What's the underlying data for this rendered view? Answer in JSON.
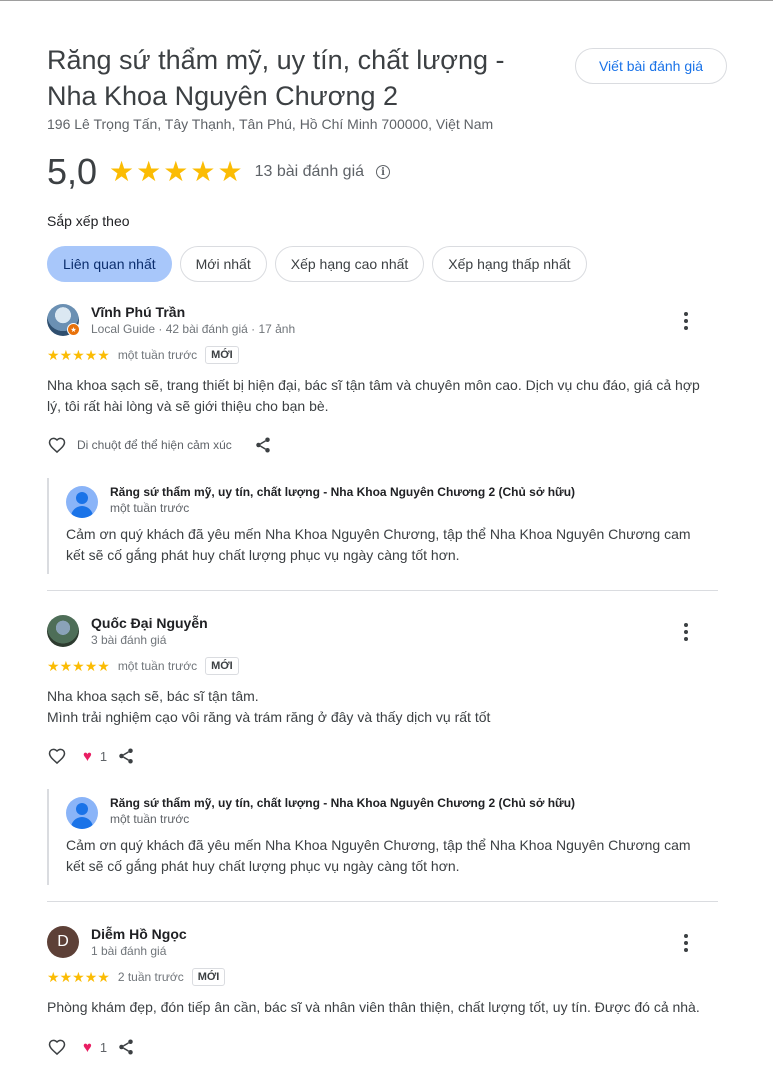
{
  "place": {
    "title": "Răng sứ thẩm mỹ, uy tín, chất lượng - Nha Khoa Nguyên Chương 2",
    "address": "196 Lê Trọng Tấn, Tây Thạnh, Tân Phú, Hồ Chí Minh 700000, Việt Nam",
    "write_review_label": "Viết bài đánh giá",
    "rating_value": "5,0",
    "rating_stars": 5,
    "review_count": "13 bài đánh giá"
  },
  "sort": {
    "label": "Sắp xếp theo",
    "options": [
      "Liên quan nhất",
      "Mới nhất",
      "Xếp hạng cao nhất",
      "Xếp hạng thấp nhất"
    ],
    "selected": "Liên quan nhất"
  },
  "colors": {
    "star": "#fbbc04",
    "accent": "#1a73e8",
    "active_chip": "#a8c7fa",
    "heart": "#e91e63"
  },
  "reviews": [
    {
      "name": "Vĩnh Phú Trần",
      "meta": "Local Guide · 42 bài đánh giá · 17 ảnh",
      "stars": 5,
      "time": "một tuần trước",
      "badge": "MỚI",
      "text": "Nha khoa sạch sẽ, trang thiết bị hiện đại, bác sĩ tận tâm và chuyên môn cao. Dịch vụ chu đáo, giá cả hợp lý, tôi rất hài lòng và sẽ giới thiệu cho bạn bè.",
      "reaction_hint": "Di chuột để thể hiện cảm xúc",
      "owner_reply": {
        "name": "Răng sứ thẩm mỹ, uy tín, chất lượng - Nha Khoa Nguyên Chương 2 (Chủ sở hữu)",
        "time": "một tuần trước",
        "text": "Cảm ơn quý khách đã yêu mến Nha Khoa Nguyên Chương, tập thể Nha Khoa Nguyên Chương cam kết sẽ cố gắng phát huy chất lượng phục vụ ngày càng tốt hơn."
      }
    },
    {
      "name": "Quốc Đại Nguyễn",
      "meta": "3 bài đánh giá",
      "stars": 5,
      "time": "một tuần trước",
      "badge": "MỚI",
      "text": "Nha khoa sạch sẽ, bác sĩ tận tâm.\nMình trải nghiệm cạo vôi răng và trám răng ở đây và thấy dịch vụ rất tốt",
      "likes": "1",
      "owner_reply": {
        "name": "Răng sứ thẩm mỹ, uy tín, chất lượng - Nha Khoa Nguyên Chương 2 (Chủ sở hữu)",
        "time": "một tuần trước",
        "text": "Cảm ơn quý khách đã yêu mến Nha Khoa Nguyên Chương, tập thể Nha Khoa Nguyên Chương cam kết sẽ cố gắng phát huy chất lượng phục vụ ngày càng tốt hơn."
      }
    },
    {
      "name": "Diễm Hồ Ngọc",
      "avatar_letter": "D",
      "meta": "1 bài đánh giá",
      "stars": 5,
      "time": "2 tuần trước",
      "badge": "MỚI",
      "text": "Phòng khám đẹp, đón tiếp ân cần, bác sĩ và nhân viên thân thiện, chất lượng tốt, uy tín. Được đó cả nhà.",
      "likes": "1"
    }
  ]
}
